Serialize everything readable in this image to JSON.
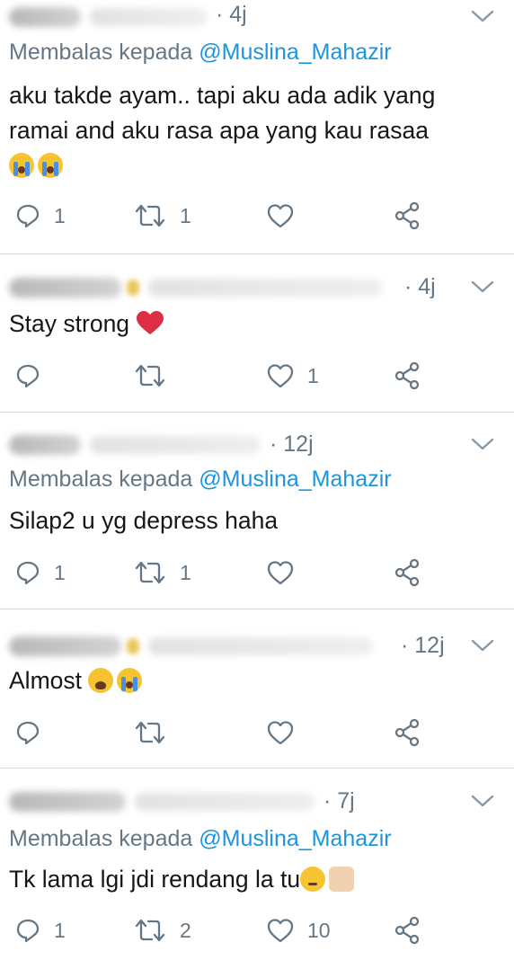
{
  "tweets": [
    {
      "time": "· 4j",
      "reply_prefix": "Membalas kepada ",
      "reply_mention": "@Muslina_Mahazir",
      "text": "aku takde ayam.. tapi aku ada adik yang ramai and aku rasa apa yang kau rasaa",
      "emojis": [
        "loudly-crying-face",
        "loudly-crying-face"
      ],
      "counts": {
        "replies": "1",
        "retweets": "1",
        "likes": ""
      }
    },
    {
      "time": "· 4j",
      "text": "Stay strong",
      "emojis": [
        "red-heart"
      ],
      "counts": {
        "replies": "",
        "retweets": "",
        "likes": "1"
      }
    },
    {
      "time": "· 12j",
      "reply_prefix": "Membalas kepada ",
      "reply_mention": "@Muslina_Mahazir",
      "text": "Silap2 u yg depress haha",
      "counts": {
        "replies": "1",
        "retweets": "1",
        "likes": ""
      }
    },
    {
      "time": "· 12j",
      "text": "Almost",
      "emojis": [
        "weary-face",
        "loudly-crying-face"
      ],
      "counts": {
        "replies": "",
        "retweets": "",
        "likes": ""
      }
    },
    {
      "time": "· 7j",
      "reply_prefix": "Membalas kepada ",
      "reply_mention": "@Muslina_Mahazir",
      "text": "Tk lama lgi jdi rendang la tu",
      "emojis": [
        "pensive-face",
        "raised-fist"
      ],
      "counts": {
        "replies": "1",
        "retweets": "2",
        "likes": "10"
      }
    }
  ],
  "colors": {
    "text": "#14171a",
    "muted": "#657786",
    "mention": "#1b95e0",
    "divider": "#d8dde2"
  },
  "icons": [
    "reply-icon",
    "retweet-icon",
    "like-icon",
    "share-icon",
    "chevron-down-icon"
  ]
}
